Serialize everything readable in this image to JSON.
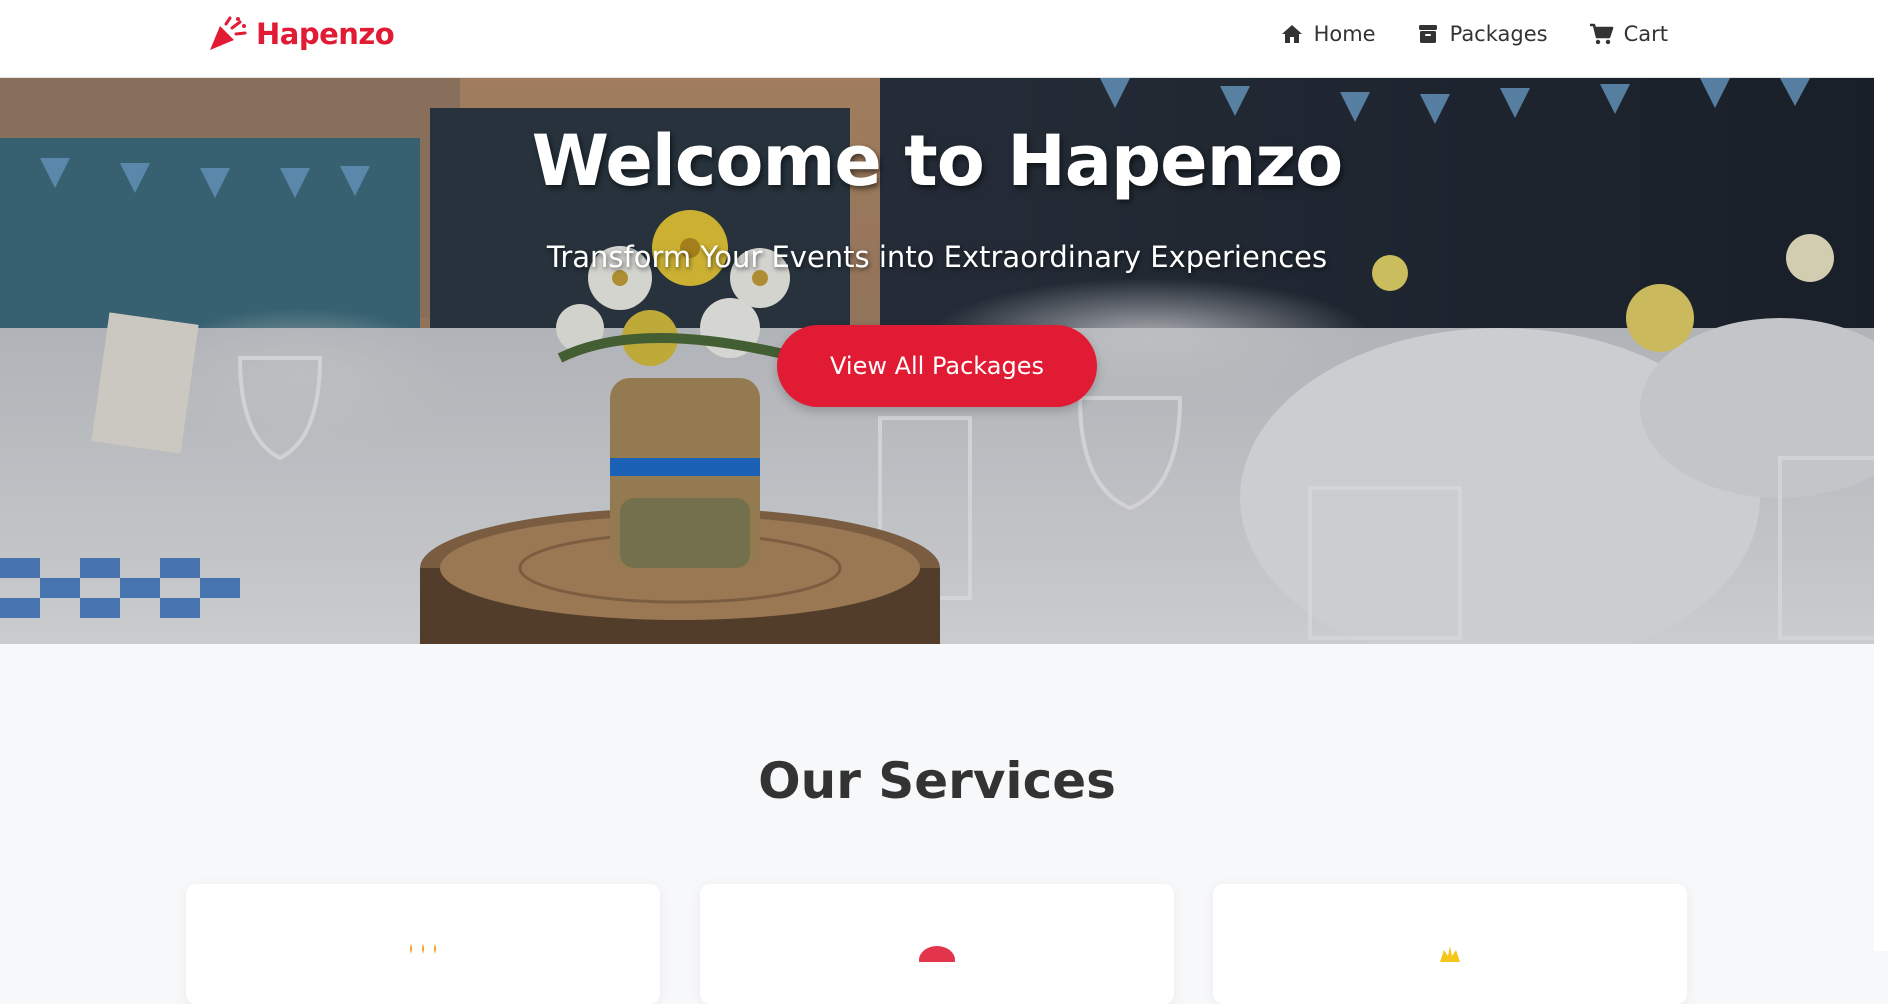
{
  "brand": {
    "name": "Hapenzo",
    "icon": "party-popper-icon",
    "color": "#e21b34"
  },
  "nav": {
    "items": [
      {
        "label": "Home",
        "icon": "home-icon"
      },
      {
        "label": "Packages",
        "icon": "archive-box-icon"
      },
      {
        "label": "Cart",
        "icon": "cart-icon"
      }
    ]
  },
  "hero": {
    "title": "Welcome to Hapenzo",
    "subtitle": "Transform Your Events into Extraordinary Experiences",
    "cta_label": "View All Packages",
    "accent": "#e21b34"
  },
  "services": {
    "title": "Our Services",
    "cards": [
      {
        "icon": "birthday-cake-icon"
      },
      {
        "icon": "balloon-icon"
      },
      {
        "icon": "crown-icon"
      }
    ]
  }
}
